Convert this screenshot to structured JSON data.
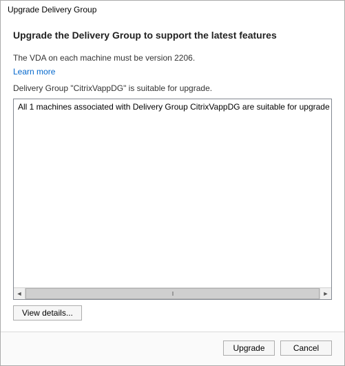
{
  "window": {
    "title": "Upgrade Delivery Group"
  },
  "main": {
    "heading": "Upgrade the Delivery Group to support the latest features",
    "vda_requirement": "The VDA on each machine must be version 2206.",
    "learn_more": "Learn more",
    "status_line": "Delivery Group \"CitrixVappDG\" is suitable for upgrade.",
    "list_item": "All 1 machines associated with Delivery Group CitrixVappDG are suitable for upgrade",
    "view_details": "View details..."
  },
  "footer": {
    "upgrade": "Upgrade",
    "cancel": "Cancel"
  }
}
